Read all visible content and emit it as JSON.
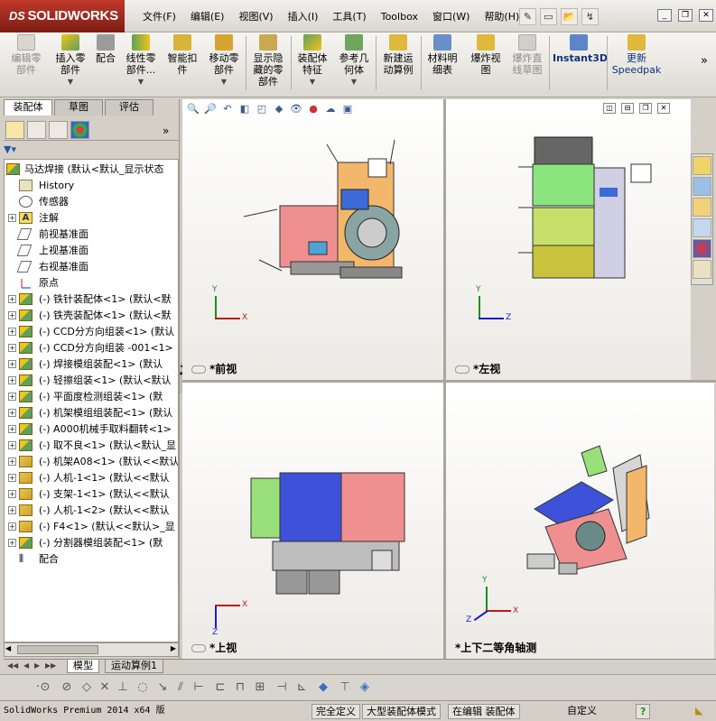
{
  "app": {
    "logo": "SOLIDWORKS",
    "logo_ds": "DS",
    "colors": {
      "logo": "#a6281b",
      "accent": "#f3c320",
      "axis_x": "#c01818",
      "axis_y": "#1d8f1d",
      "axis_z": "#1b1bd6"
    }
  },
  "menu": [
    "文件(F)",
    "编辑(E)",
    "视图(V)",
    "插入(I)",
    "工具(T)",
    "Toolbox",
    "窗口(W)",
    "帮助(H)"
  ],
  "title_tools": [
    "new-doc-icon",
    "open-icon",
    "print-icon",
    "options-icon",
    "rebuild-icon"
  ],
  "commands": [
    {
      "label": "编辑零\n部件",
      "icon": "edit-component-icon",
      "disabled": true
    },
    {
      "label": "插入零\n部件",
      "icon": "insert-component-icon",
      "disabled": false,
      "dropdown": true
    },
    {
      "label": "配合",
      "icon": "mate-icon",
      "disabled": false
    },
    {
      "label": "线性零\n部件...",
      "icon": "linear-pattern-icon",
      "disabled": false,
      "dropdown": true
    },
    {
      "label": "智能扣\n件",
      "icon": "smart-fasteners-icon",
      "disabled": false
    },
    {
      "label": "移动零\n部件",
      "icon": "move-component-icon",
      "disabled": false,
      "dropdown": true
    },
    {
      "label": "显示隐\n藏的零\n部件",
      "icon": "show-hidden-icon",
      "disabled": false
    },
    {
      "label": "装配体\n特征",
      "icon": "assembly-feature-icon",
      "disabled": false,
      "dropdown": true
    },
    {
      "label": "参考几\n何体",
      "icon": "reference-geometry-icon",
      "disabled": false,
      "dropdown": true
    },
    {
      "label": "新建运\n动算例",
      "icon": "new-motion-study-icon",
      "disabled": false
    },
    {
      "label": "材料明\n细表",
      "icon": "bom-icon",
      "disabled": false
    },
    {
      "label": "爆炸视\n图",
      "icon": "exploded-view-icon",
      "disabled": false
    },
    {
      "label": "爆炸直\n线草图",
      "icon": "explode-line-sketch-icon",
      "disabled": true
    },
    {
      "label": "Instant3D",
      "icon": "instant3d-icon",
      "disabled": false
    },
    {
      "label": "更新\nSpeedpak",
      "icon": "speedpak-icon",
      "disabled": false
    }
  ],
  "panel_tabs": [
    "装配体",
    "草图",
    "评估"
  ],
  "tree": {
    "root": "马达焊接  (默认<默认_显示状态",
    "items": [
      {
        "label": "History",
        "icon": "history-icon",
        "exp": false
      },
      {
        "label": "传感器",
        "icon": "sensor-icon",
        "exp": false
      },
      {
        "label": "注解",
        "icon": "annotation-icon",
        "exp": true
      },
      {
        "label": "前视基准面",
        "icon": "plane-icon",
        "exp": false
      },
      {
        "label": "上视基准面",
        "icon": "plane-icon",
        "exp": false
      },
      {
        "label": "右视基准面",
        "icon": "plane-icon",
        "exp": false
      },
      {
        "label": "原点",
        "icon": "origin-icon",
        "exp": false
      },
      {
        "label": "(-) 铁针装配体<1> (默认<默",
        "icon": "assembly-icon",
        "exp": true
      },
      {
        "label": "(-) 铁壳装配体<1> (默认<默",
        "icon": "assembly-icon",
        "exp": true
      },
      {
        "label": "(-) CCD分方向组装<1> (默认",
        "icon": "assembly-icon",
        "exp": true
      },
      {
        "label": "(-) CCD分方向组装 -001<1>",
        "icon": "assembly-icon",
        "exp": true
      },
      {
        "label": "(-) 焊接模组装配<1> (默认",
        "icon": "assembly-icon",
        "exp": true
      },
      {
        "label": "(-) 轻擦组装<1> (默认<默认",
        "icon": "assembly-icon",
        "exp": true
      },
      {
        "label": "(-) 平面度检测组装<1> (默",
        "icon": "assembly-icon",
        "exp": true
      },
      {
        "label": "(-) 机架模组组装配<1> (默认",
        "icon": "assembly-icon",
        "exp": true
      },
      {
        "label": "(-) A000机械手取料翻转<1>",
        "icon": "assembly-icon",
        "exp": true
      },
      {
        "label": "(-) 取不良<1> (默认<默认_显",
        "icon": "assembly-icon",
        "exp": true
      },
      {
        "label": "(-) 机架A08<1> (默认<<默认",
        "icon": "part-icon",
        "exp": true
      },
      {
        "label": "(-) 人机-1<1> (默认<<默认",
        "icon": "part-icon",
        "exp": true
      },
      {
        "label": "(-) 支架-1<1> (默认<<默认",
        "icon": "part-icon",
        "exp": true
      },
      {
        "label": "(-) 人机-1<2> (默认<<默认",
        "icon": "part-icon",
        "exp": true
      },
      {
        "label": "(-) F4<1> (默认<<默认>_显",
        "icon": "part-icon",
        "exp": true
      },
      {
        "label": "(-) 分割器模组装配<1> (默",
        "icon": "assembly-icon",
        "exp": true
      },
      {
        "label": "配合",
        "icon": "mates-icon",
        "exp": false
      }
    ]
  },
  "bottom_tabs": [
    "模型",
    "运动算例1"
  ],
  "viewports": {
    "front": "*前视",
    "left": "*左视",
    "top": "*上视",
    "iso": "*上下二等角轴测"
  },
  "axes": {
    "x": "X",
    "y": "Y",
    "z": "Z"
  },
  "status": {
    "app": "SolidWorks Premium 2014 x64 版",
    "fully_defined": "完全定义",
    "mode": "大型装配体模式",
    "editing": "在编辑 装配体",
    "custom": "自定义",
    "help": "?"
  }
}
